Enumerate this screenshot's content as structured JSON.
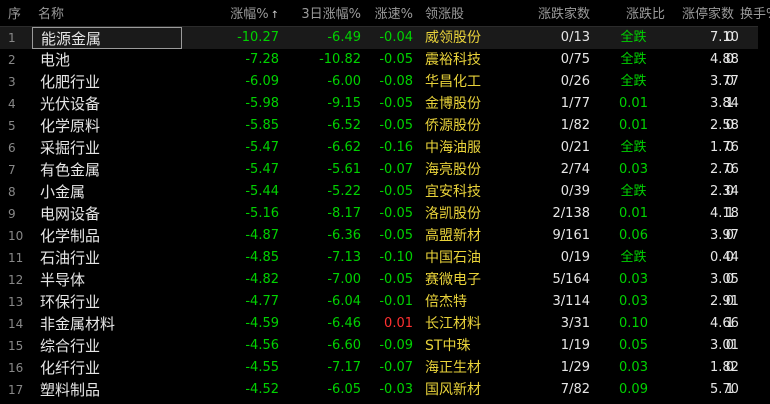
{
  "header": {
    "seq": "序",
    "name": "名称",
    "change_pct": "涨幅%",
    "sort_icon": "↑",
    "change_3d_pct": "3日涨幅%",
    "speed_pct": "涨速%",
    "leading_stock": "领涨股",
    "up_down_count": "涨跌家数",
    "up_down_ratio": "涨跌比",
    "limit_up_count": "涨停家数",
    "turnover_pct": "换手%"
  },
  "rows": [
    {
      "seq": "1",
      "name": "能源金属",
      "change": "-10.27",
      "change3d": "-6.49",
      "speed": "-0.04",
      "speed_color": "green",
      "lead": "威领股份",
      "updown": "0/13",
      "ratio": "全跌",
      "limit": "0",
      "turnover": "7.10"
    },
    {
      "seq": "2",
      "name": "电池",
      "change": "-7.28",
      "change3d": "-10.82",
      "speed": "-0.05",
      "speed_color": "green",
      "lead": "震裕科技",
      "updown": "0/75",
      "ratio": "全跌",
      "limit": "0",
      "turnover": "4.88"
    },
    {
      "seq": "3",
      "name": "化肥行业",
      "change": "-6.09",
      "change3d": "-6.00",
      "speed": "-0.08",
      "speed_color": "green",
      "lead": "华昌化工",
      "updown": "0/26",
      "ratio": "全跌",
      "limit": "0",
      "turnover": "3.77"
    },
    {
      "seq": "4",
      "name": "光伏设备",
      "change": "-5.98",
      "change3d": "-9.15",
      "speed": "-0.05",
      "speed_color": "green",
      "lead": "金博股份",
      "updown": "1/77",
      "ratio": "0.01",
      "limit": "1",
      "turnover": "3.84"
    },
    {
      "seq": "5",
      "name": "化学原料",
      "change": "-5.85",
      "change3d": "-6.52",
      "speed": "-0.05",
      "speed_color": "green",
      "lead": "侨源股份",
      "updown": "1/82",
      "ratio": "0.01",
      "limit": "0",
      "turnover": "2.58"
    },
    {
      "seq": "6",
      "name": "采掘行业",
      "change": "-5.47",
      "change3d": "-6.62",
      "speed": "-0.16",
      "speed_color": "green",
      "lead": "中海油服",
      "updown": "0/21",
      "ratio": "全跌",
      "limit": "0",
      "turnover": "1.76"
    },
    {
      "seq": "7",
      "name": "有色金属",
      "change": "-5.47",
      "change3d": "-5.61",
      "speed": "-0.07",
      "speed_color": "green",
      "lead": "海亮股份",
      "updown": "2/74",
      "ratio": "0.03",
      "limit": "0",
      "turnover": "2.76"
    },
    {
      "seq": "8",
      "name": "小金属",
      "change": "-5.44",
      "change3d": "-5.22",
      "speed": "-0.05",
      "speed_color": "green",
      "lead": "宜安科技",
      "updown": "0/39",
      "ratio": "全跌",
      "limit": "0",
      "turnover": "2.34"
    },
    {
      "seq": "9",
      "name": "电网设备",
      "change": "-5.16",
      "change3d": "-8.17",
      "speed": "-0.05",
      "speed_color": "green",
      "lead": "洛凯股份",
      "updown": "2/138",
      "ratio": "0.01",
      "limit": "1",
      "turnover": "4.18"
    },
    {
      "seq": "10",
      "name": "化学制品",
      "change": "-4.87",
      "change3d": "-6.36",
      "speed": "-0.05",
      "speed_color": "green",
      "lead": "高盟新材",
      "updown": "9/161",
      "ratio": "0.06",
      "limit": "0",
      "turnover": "3.97"
    },
    {
      "seq": "11",
      "name": "石油行业",
      "change": "-4.85",
      "change3d": "-7.13",
      "speed": "-0.10",
      "speed_color": "green",
      "lead": "中国石油",
      "updown": "0/19",
      "ratio": "全跌",
      "limit": "0",
      "turnover": "0.44"
    },
    {
      "seq": "12",
      "name": "半导体",
      "change": "-4.82",
      "change3d": "-7.00",
      "speed": "-0.05",
      "speed_color": "green",
      "lead": "赛微电子",
      "updown": "5/164",
      "ratio": "0.03",
      "limit": "0",
      "turnover": "3.05"
    },
    {
      "seq": "13",
      "name": "环保行业",
      "change": "-4.77",
      "change3d": "-6.04",
      "speed": "-0.01",
      "speed_color": "green",
      "lead": "倍杰特",
      "updown": "3/114",
      "ratio": "0.03",
      "limit": "0",
      "turnover": "2.91"
    },
    {
      "seq": "14",
      "name": "非金属材料",
      "change": "-4.59",
      "change3d": "-6.46",
      "speed": "0.01",
      "speed_color": "red",
      "lead": "长江材料",
      "updown": "3/31",
      "ratio": "0.10",
      "limit": "1",
      "turnover": "4.66"
    },
    {
      "seq": "15",
      "name": "综合行业",
      "change": "-4.56",
      "change3d": "-6.60",
      "speed": "-0.09",
      "speed_color": "green",
      "lead": "ST中珠",
      "updown": "1/19",
      "ratio": "0.05",
      "limit": "0",
      "turnover": "3.01"
    },
    {
      "seq": "16",
      "name": "化纤行业",
      "change": "-4.55",
      "change3d": "-7.17",
      "speed": "-0.07",
      "speed_color": "green",
      "lead": "海正生材",
      "updown": "1/29",
      "ratio": "0.03",
      "limit": "0",
      "turnover": "1.82"
    },
    {
      "seq": "17",
      "name": "塑料制品",
      "change": "-4.52",
      "change3d": "-6.05",
      "speed": "-0.03",
      "speed_color": "green",
      "lead": "国风新材",
      "updown": "7/82",
      "ratio": "0.09",
      "limit": "1",
      "turnover": "5.70"
    }
  ],
  "colors": {
    "down": "#00d200",
    "up": "#ff3030",
    "lead": "#e8d23a"
  }
}
